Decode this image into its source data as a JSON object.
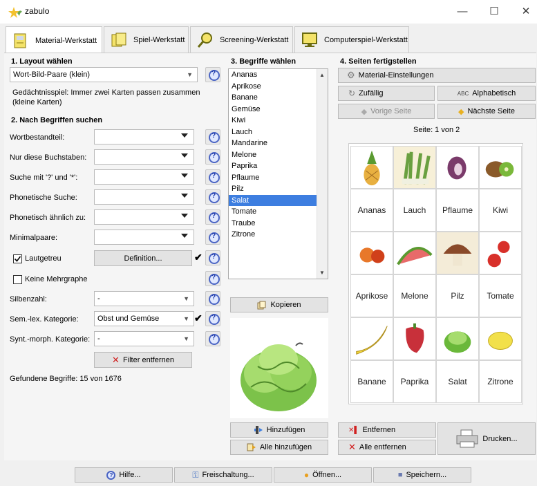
{
  "window": {
    "title": "zabulo"
  },
  "tabs": [
    {
      "label": "Material-Werkstatt",
      "icon": "material-workshop-icon"
    },
    {
      "label": "Spiel-Werkstatt",
      "icon": "game-workshop-icon"
    },
    {
      "label": "Screening-Werkstatt",
      "icon": "magnifier-icon"
    },
    {
      "label": "Computerspiel-Werkstatt",
      "icon": "monitor-icon"
    }
  ],
  "layout": {
    "heading": "1. Layout wählen",
    "selected": "Wort-Bild-Paare (klein)",
    "description": "Gedächtnisspiel: Immer zwei Karten passen zusammen (kleine Karten)"
  },
  "search": {
    "heading": "2. Nach Begriffen suchen",
    "fields": [
      {
        "label": "Wortbestandteil:"
      },
      {
        "label": "Nur diese Buchstaben:"
      },
      {
        "label": "Suche mit '?' und '*':"
      },
      {
        "label": "Phonetische Suche:"
      },
      {
        "label": "Phonetisch ähnlich zu:"
      },
      {
        "label": "Minimalpaare:"
      }
    ],
    "lautgetreu_label": "Lautgetreu",
    "definition_button": "Definition...",
    "keine_mehrgraphe_label": "Keine Mehrgraphe",
    "silbenzahl_label": "Silbenzahl:",
    "silbenzahl_value": "-",
    "sem_label": "Sem.-lex. Kategorie:",
    "sem_value": "Obst und Gemüse",
    "synt_label": "Synt.-morph. Kategorie:",
    "synt_value": "-",
    "filter_button": "Filter entfernen",
    "found_text": "Gefundene Begriffe: 15 von 1676"
  },
  "terms": {
    "heading": "3. Begriffe wählen",
    "items": [
      "Ananas",
      "Aprikose",
      "Banane",
      "Gemüse",
      "Kiwi",
      "Lauch",
      "Mandarine",
      "Melone",
      "Paprika",
      "Pflaume",
      "Pilz",
      "Salat",
      "Tomate",
      "Traube",
      "Zitrone"
    ],
    "selected": "Salat",
    "copy_button": "Kopieren",
    "add_button": "Hinzufügen",
    "add_all_button": "Alle hinzufügen"
  },
  "pages": {
    "heading": "4. Seiten fertigstellen",
    "material_settings": "Material-Einstellungen",
    "random": "Zufällig",
    "alphabetic": "Alphabetisch",
    "abc_prefix": "ABC",
    "prev_page": "Vorige Seite",
    "next_page": "Nächste Seite",
    "page_info": "Seite: 1 von 2",
    "remove": "Entfernen",
    "remove_all": "Alle entfernen",
    "print": "Drucken..."
  },
  "cards": {
    "row1": [
      "Ananas",
      "Lauch",
      "Pflaume",
      "Kiwi"
    ],
    "row2": [
      "Aprikose",
      "Melone",
      "Pilz",
      "Tomate"
    ],
    "row3": [
      "Banane",
      "Paprika",
      "Salat",
      "Zitrone"
    ]
  },
  "bottom": {
    "help": "Hilfe...",
    "unlock": "Freischaltung...",
    "open": "Öffnen...",
    "save": "Speichern..."
  },
  "colors": {
    "selection": "#3d7ee0",
    "help_icon": "#4a64c4"
  }
}
